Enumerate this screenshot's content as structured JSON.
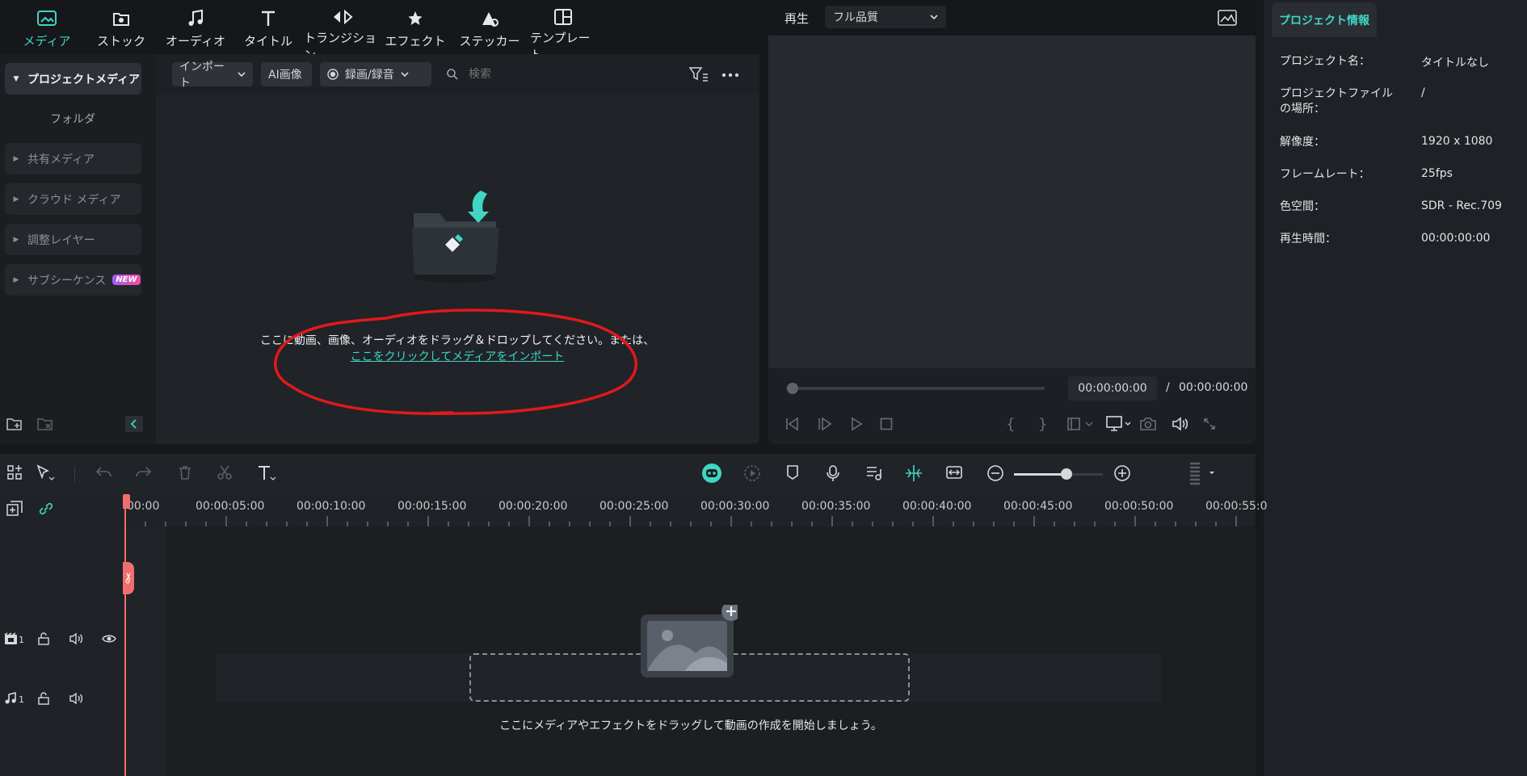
{
  "top_tabs": [
    {
      "label": "メディア",
      "icon": "media-icon"
    },
    {
      "label": "ストック",
      "icon": "stock-icon"
    },
    {
      "label": "オーディオ",
      "icon": "music-note-icon"
    },
    {
      "label": "タイトル",
      "icon": "title-icon"
    },
    {
      "label": "トランジション",
      "icon": "transition-icon"
    },
    {
      "label": "エフェクト",
      "icon": "effect-icon"
    },
    {
      "label": "ステッカー",
      "icon": "sticker-icon"
    },
    {
      "label": "テンプレート",
      "icon": "template-icon"
    }
  ],
  "sidebar": {
    "items": [
      {
        "label": "プロジェクトメディア"
      },
      {
        "label": "フォルダ"
      },
      {
        "label": "共有メディア"
      },
      {
        "label": "クラウド メディア"
      },
      {
        "label": "調整レイヤー"
      },
      {
        "label": "サブシーケンス"
      }
    ],
    "new_badge": "NEW"
  },
  "media_toolbar": {
    "import_label": "インポート",
    "ai_image_label": "AI画像",
    "record_label": "録画/録音",
    "search_placeholder": "検索"
  },
  "drop_area": {
    "text": "ここに動画、画像、オーディオをドラッグ＆ドロップしてください。または、",
    "link": "ここをクリックしてメディアをインポート"
  },
  "preview": {
    "play_label": "再生",
    "quality": "フル品質",
    "current_time": "00:00:00:00",
    "separator": "/",
    "total_time": "00:00:00:00"
  },
  "project_info": {
    "tab_label": "プロジェクト情報",
    "rows": [
      {
        "label": "プロジェクト名：",
        "value": "タイトルなし"
      },
      {
        "label": "プロジェクトファイルの場所：",
        "value": "/"
      },
      {
        "label": "解像度：",
        "value": "1920 x 1080"
      },
      {
        "label": "フレームレート：",
        "value": "25fps"
      },
      {
        "label": "色空間：",
        "value": "SDR - Rec.709"
      },
      {
        "label": "再生時間：",
        "value": "00:00:00:00"
      }
    ]
  },
  "timeline": {
    "ruler_labels": [
      "00:00",
      "00:00:05:00",
      "00:00:10:00",
      "00:00:15:00",
      "00:00:20:00",
      "00:00:25:00",
      "00:00:30:00",
      "00:00:35:00",
      "00:00:40:00",
      "00:00:45:00",
      "00:00:50:00",
      "00:00:55:0"
    ],
    "video_track_number": "1",
    "audio_track_number": "1",
    "drop_hint": "ここにメディアやエフェクトをドラッグして動画の作成を開始しましょう。"
  },
  "colors": {
    "accent": "#3fd6c3",
    "annotation": "#e0191b",
    "playhead": "#f26d6d"
  }
}
